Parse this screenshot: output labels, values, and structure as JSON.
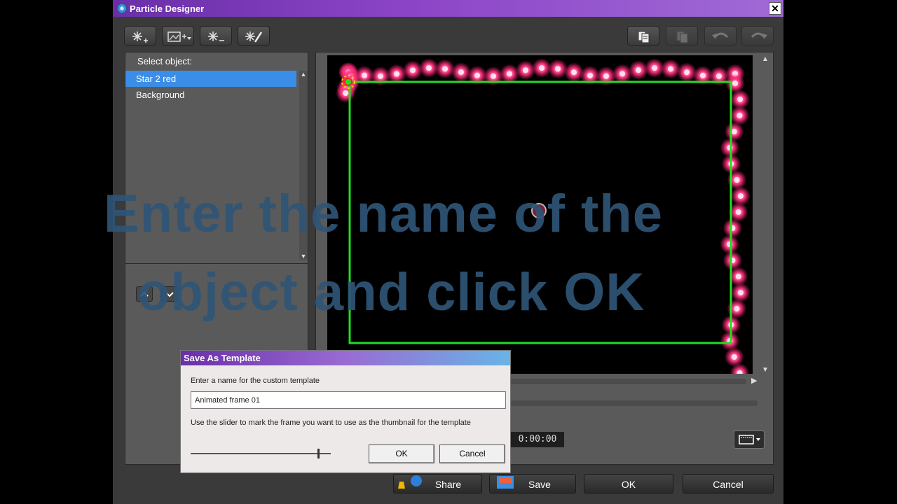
{
  "window": {
    "title": "Particle Designer",
    "close_label": "✕"
  },
  "toolbar": {
    "left_icons": [
      "add-particle-icon",
      "insert-image-icon",
      "remove-particle-icon",
      "edit-particle-icon"
    ],
    "right_icons": [
      "copy-icon",
      "paste-icon",
      "undo-icon",
      "redo-icon"
    ]
  },
  "left_panel": {
    "label": "Select object:",
    "objects": [
      "Star 2 red",
      "Background"
    ],
    "selected_index": 0
  },
  "preview": {
    "timecode": "0:00:00"
  },
  "footer": {
    "share_label": "Share",
    "save_label": "Save",
    "ok_label": "OK",
    "cancel_label": "Cancel"
  },
  "overlay": {
    "line1": "Enter the name of the",
    "line2": "object and click OK"
  },
  "dialog": {
    "title": "Save As Template",
    "prompt": "Enter a name for the custom template",
    "input_value": "Animated frame 01",
    "hint": "Use the slider to mark the frame you want to use as the thumbnail for the template",
    "slider_value": 0.92,
    "ok_label": "OK",
    "cancel_label": "Cancel"
  },
  "colors": {
    "accent": "#3b8ee8",
    "title_purple": "#7a3bb8",
    "frame_green": "#22dd22",
    "particle_pink": "#ff2a78"
  }
}
